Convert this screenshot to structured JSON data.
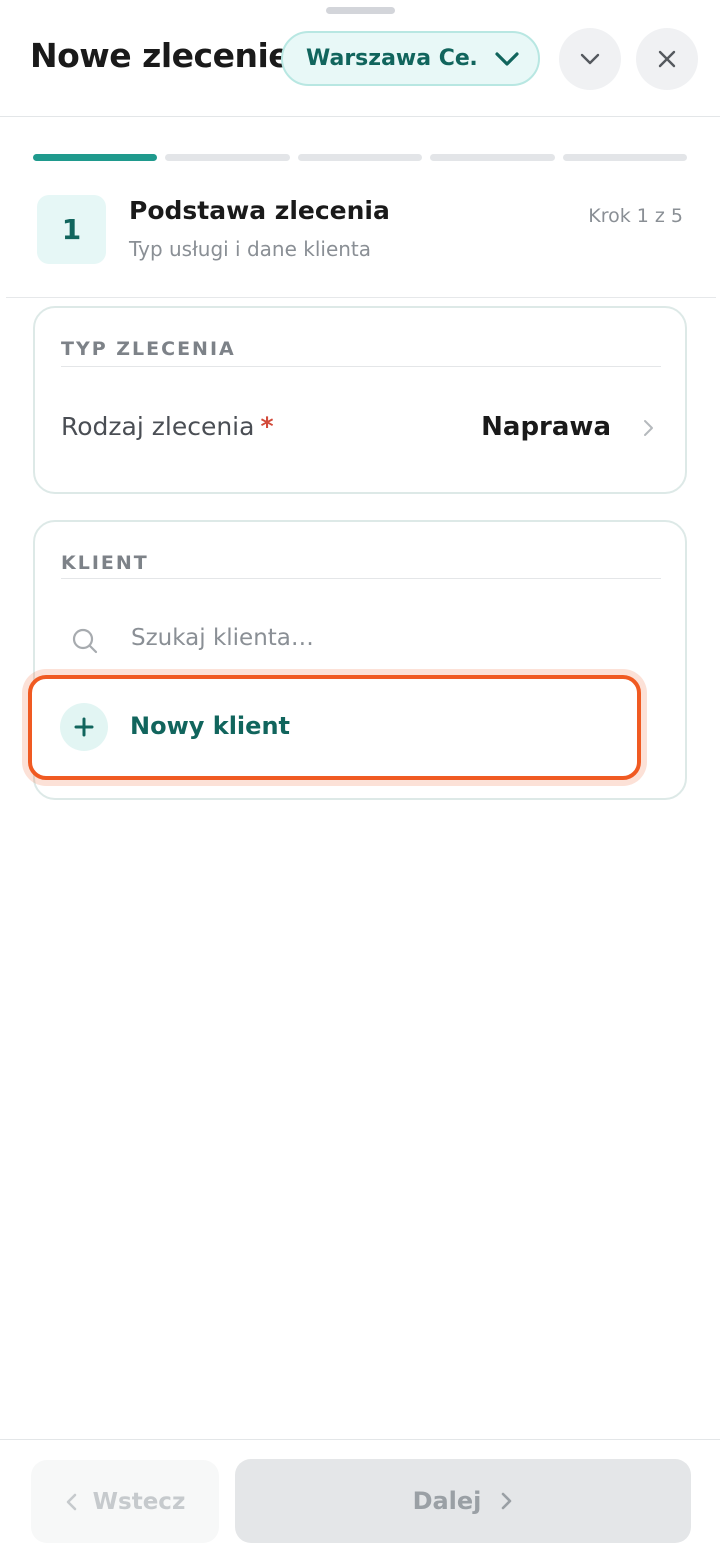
{
  "header": {
    "title": "Nowe zlecenie",
    "branch_select": {
      "value": "Warszawa Ce…",
      "icon": "chevron-down-icon",
      "accent": "#11655d"
    },
    "collapse_icon": "chevron-down-icon",
    "close_icon": "close-icon"
  },
  "progress": {
    "current_step": 1,
    "total_steps": 5,
    "active_color": "#1f9a8d"
  },
  "step": {
    "number": "1",
    "title": "Podstawa zlecenia",
    "subtitle": "Typ usługi i dane klienta",
    "counter": "Krok 1 z 5"
  },
  "order_type_card": {
    "section_label": "TYP ZLECENIA",
    "field_label": "Rodzaj zlecenia",
    "required_mark": "*",
    "value": "Naprawa"
  },
  "client_card": {
    "section_label": "KLIENT",
    "search_placeholder": "Szukaj klienta…",
    "new_client_label": "Nowy klient",
    "highlight_color": "#f05a22"
  },
  "footer": {
    "back_label": "Wstecz",
    "next_label": "Dalej"
  }
}
